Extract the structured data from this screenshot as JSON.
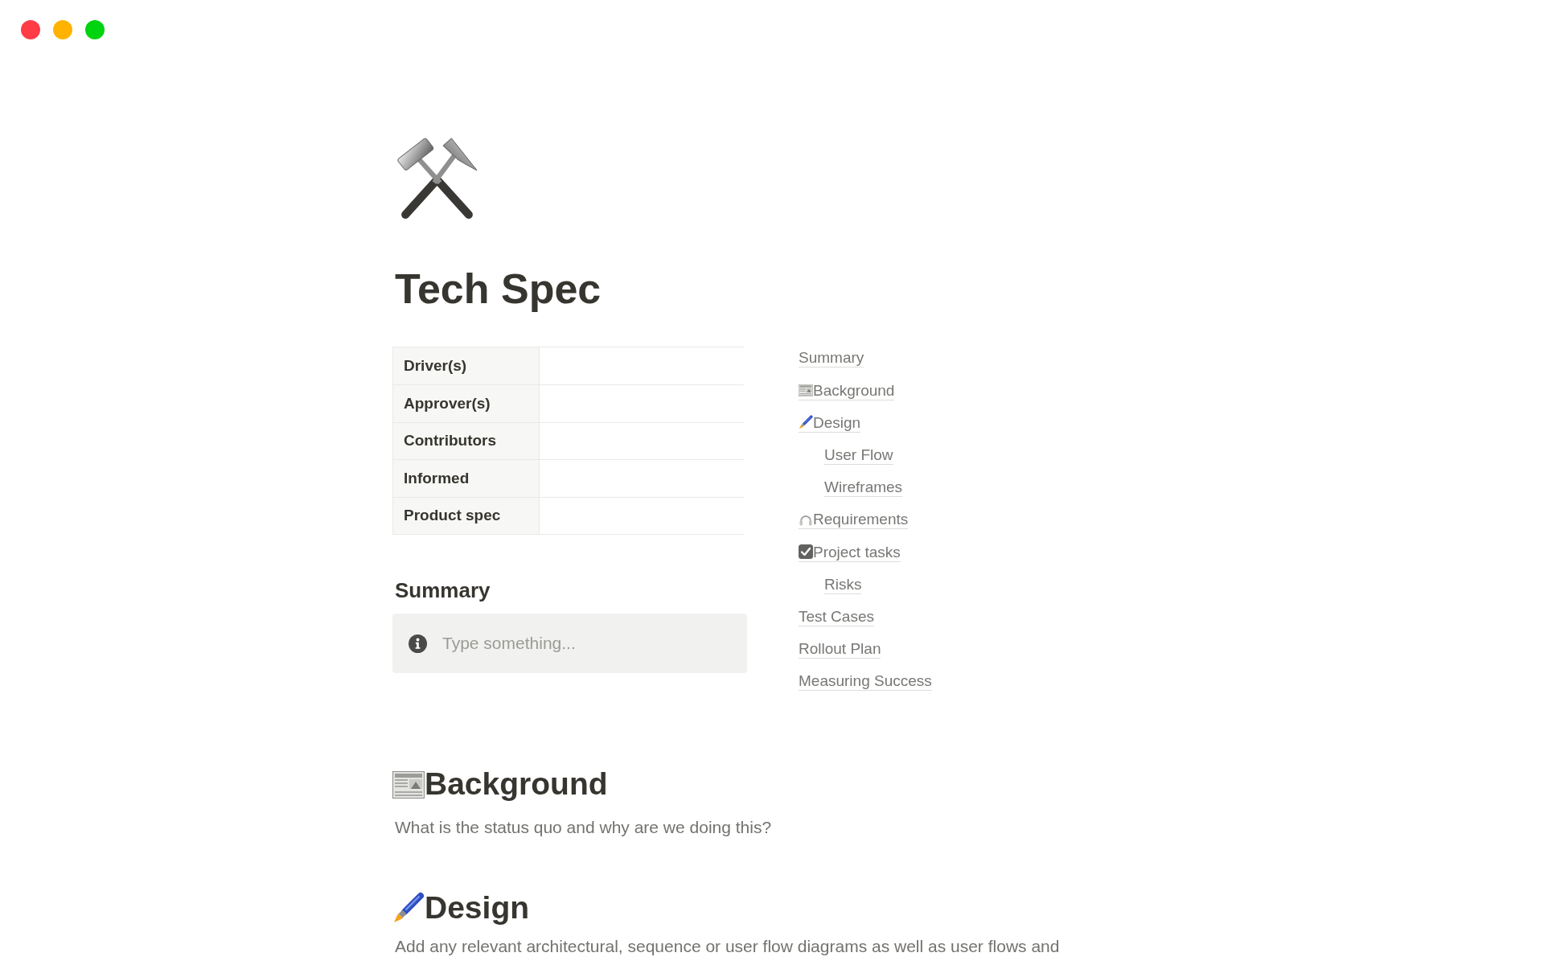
{
  "page": {
    "title": "Tech Spec"
  },
  "properties_table": {
    "rows": [
      {
        "label": "Driver(s)"
      },
      {
        "label": "Approver(s)"
      },
      {
        "label": "Contributors"
      },
      {
        "label": "Informed"
      },
      {
        "label": "Product spec"
      }
    ]
  },
  "summary": {
    "heading": "Summary",
    "callout": {
      "placeholder": "Type something..."
    }
  },
  "table_of_contents": {
    "items": [
      {
        "label": "Summary",
        "kind": "plain"
      },
      {
        "label": "Background",
        "kind": "newspaper"
      },
      {
        "label": "Design",
        "kind": "brush",
        "children": [
          {
            "label": "User Flow",
            "kind": "plain"
          },
          {
            "label": "Wireframes",
            "kind": "plain"
          }
        ]
      },
      {
        "label": "Requirements",
        "kind": "headphones"
      },
      {
        "label": "Project tasks",
        "kind": "check",
        "children": [
          {
            "label": "Risks",
            "kind": "plain"
          }
        ]
      },
      {
        "label": "Test Cases",
        "kind": "plain"
      },
      {
        "label": "Rollout Plan",
        "kind": "plain"
      },
      {
        "label": "Measuring Success",
        "kind": "plain"
      }
    ]
  },
  "sections": [
    {
      "heading": "Background",
      "kind": "newspaper",
      "text": "What is the status quo and why are we doing this?"
    },
    {
      "heading": "Design",
      "kind": "brush",
      "text": "Add any relevant architectural, sequence or user flow diagrams as well as user flows and"
    }
  ]
}
